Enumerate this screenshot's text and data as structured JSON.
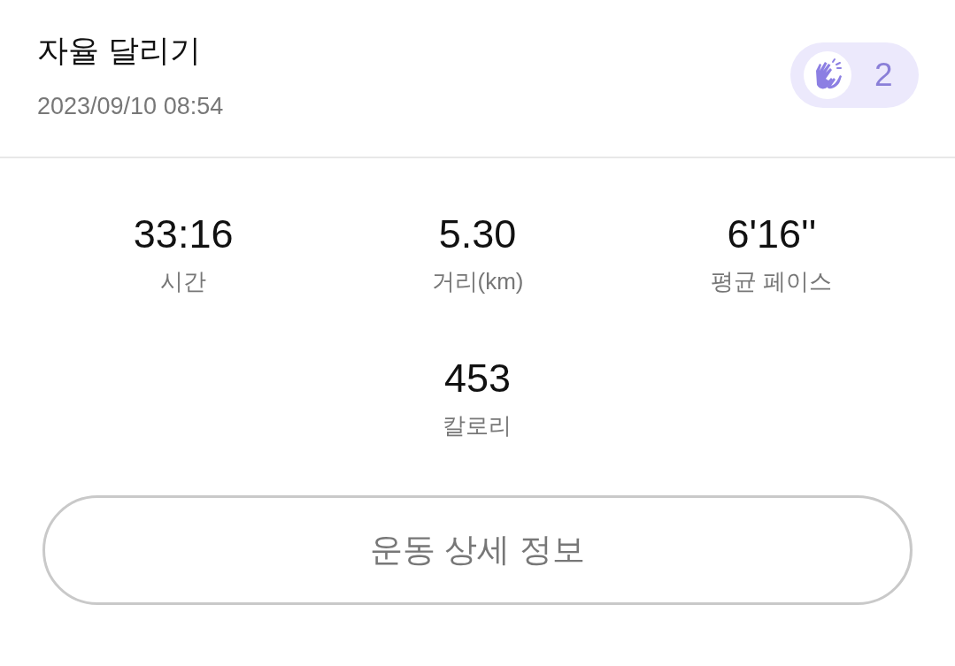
{
  "header": {
    "title": "자율 달리기",
    "datetime": "2023/09/10 08:54",
    "clap_badge": {
      "count": "2"
    }
  },
  "stats": [
    {
      "value": "33:16",
      "label": "시간"
    },
    {
      "value": "5.30",
      "label": "거리(km)"
    },
    {
      "value": "6'16''",
      "label": "평균 페이스"
    },
    {
      "value": "453",
      "label": "칼로리"
    }
  ],
  "detail_button": {
    "label": "운동 상세 정보"
  }
}
